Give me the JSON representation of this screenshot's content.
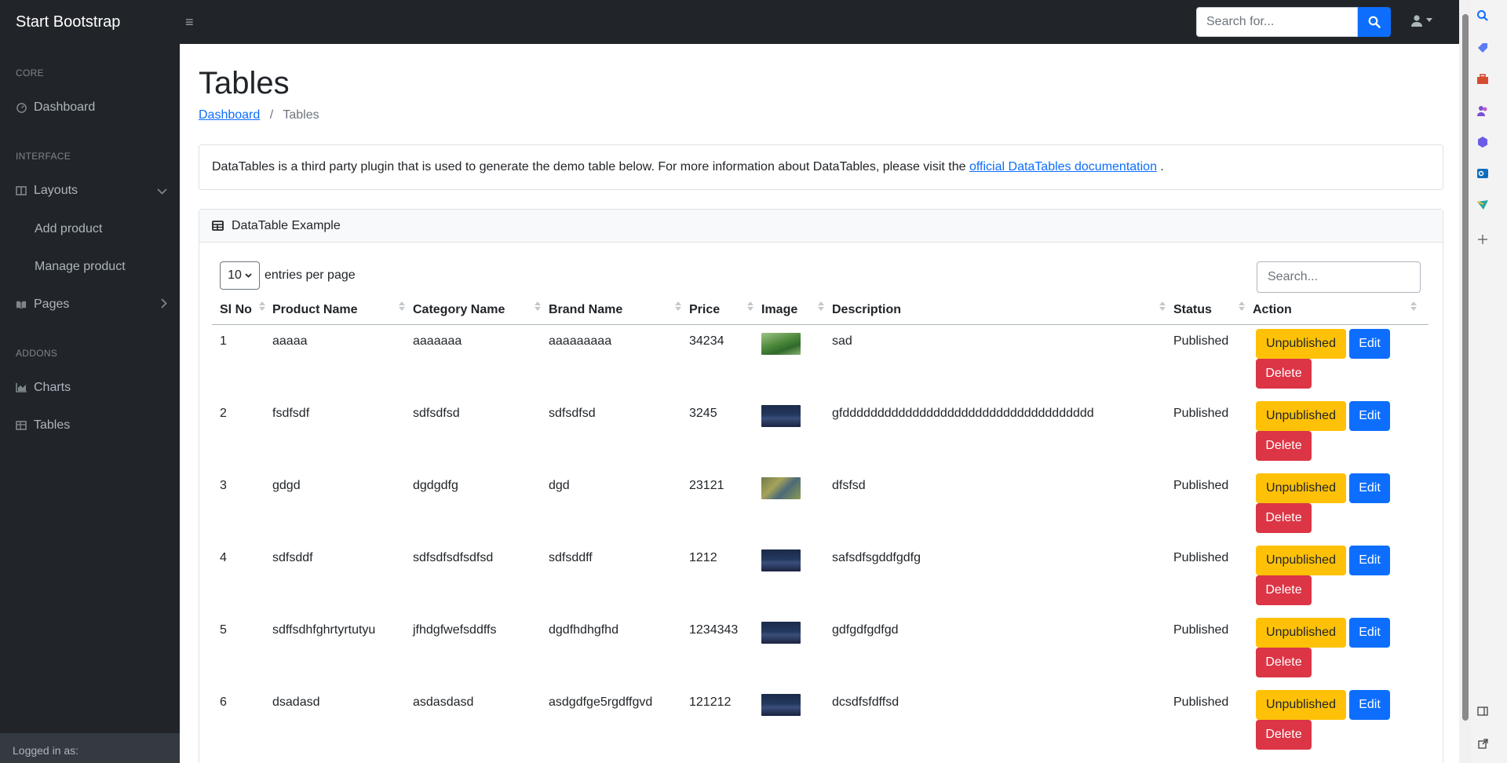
{
  "navbar": {
    "brand": "Start Bootstrap",
    "search_placeholder": "Search for..."
  },
  "sidebar": {
    "headings": [
      "Core",
      "Interface",
      "Addons"
    ],
    "items": [
      {
        "label": "Dashboard",
        "icon": "dashboard-icon"
      },
      {
        "label": "Layouts",
        "icon": "columns-icon"
      },
      {
        "label": "Add product"
      },
      {
        "label": "Manage product"
      },
      {
        "label": "Pages",
        "icon": "book-icon"
      },
      {
        "label": "Charts",
        "icon": "chart-area-icon"
      },
      {
        "label": "Tables",
        "icon": "table-icon"
      }
    ],
    "footer": "Logged in as:"
  },
  "page": {
    "title": "Tables",
    "breadcrumb": {
      "link": "Dashboard",
      "separator": "/",
      "current": "Tables"
    },
    "info": {
      "text": "DataTables is a third party plugin that is used to generate the demo table below. For more information about DataTables, please visit the ",
      "link": "official DataTables documentation",
      "suffix": " ."
    }
  },
  "datatable": {
    "header": "DataTable Example",
    "entries_value": "10",
    "entries_label": "entries per page",
    "search_placeholder": "Search...",
    "columns": [
      "Sl No",
      "Product Name",
      "Category Name",
      "Brand Name",
      "Price",
      "Image",
      "Description",
      "Status",
      "Action"
    ],
    "rows": [
      {
        "sl": "1",
        "product": "aaaaa",
        "category": "aaaaaaa",
        "brand": "aaaaaaaaa",
        "price": "34234",
        "image": "green-field",
        "description": "sad",
        "status": "Published"
      },
      {
        "sl": "2",
        "product": "fsdfsdf",
        "category": "sdfsdfsd",
        "brand": "sdfsdfsd",
        "price": "3245",
        "image": "night-bridge",
        "description": "gfdddddddddddddddddddddddddddddddddddd",
        "status": "Published"
      },
      {
        "sl": "3",
        "product": "gdgd",
        "category": "dgdgdfg",
        "brand": "dgd",
        "price": "23121",
        "image": "flowers",
        "description": "dfsfsd",
        "status": "Published"
      },
      {
        "sl": "4",
        "product": "sdfsddf",
        "category": "sdfsdfsdfsdfsd",
        "brand": "sdfsddff",
        "price": "1212",
        "image": "night-bridge",
        "description": "safsdfsgddfgdfg",
        "status": "Published"
      },
      {
        "sl": "5",
        "product": "sdffsdhfghrtyrtutyu",
        "category": "jfhdgfwefsddffs",
        "brand": "dgdfhdhgfhd",
        "price": "1234343",
        "image": "night-bridge",
        "description": "gdfgdfgdfgd",
        "status": "Published"
      },
      {
        "sl": "6",
        "product": "dsadasd",
        "category": "asdasdasd",
        "brand": "asdgdfge5rgdffgvd",
        "price": "121212",
        "image": "night-bridge",
        "description": "dcsdfsfdffsd",
        "status": "Published"
      }
    ],
    "buttons": {
      "unpublish": "Unpublished",
      "edit": "Edit",
      "delete": "Delete"
    }
  },
  "colors": {
    "primary": "#0d6efd",
    "warning": "#ffc107",
    "danger": "#dc3545",
    "dark": "#212529"
  }
}
